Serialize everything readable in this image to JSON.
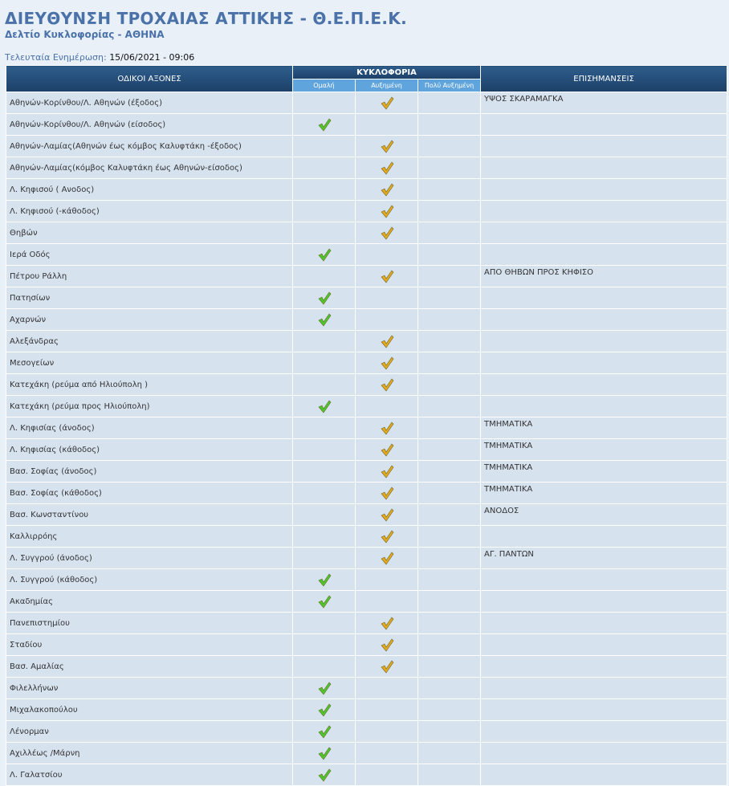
{
  "header": {
    "title": "ΔΙΕΥΘΥΝΣΗ ΤΡΟΧΑΙΑΣ ΑΤΤΙΚΗΣ - Θ.Ε.Π.Ε.Κ.",
    "subtitle": "Δελτίο Κυκλοφορίας - ΑΘΗΝΑ",
    "updated_label": "Τελευταία Ενημέρωση:",
    "updated_value": "15/06/2021 - 09:06"
  },
  "table": {
    "col_roads": "ΟΔΙΚΟΙ ΑΞΟΝΕΣ",
    "col_traffic": "ΚΥΚΛΟΦΟΡΙΑ",
    "col_notes": "ΕΠΙΣΗΜΑΝΣΕΙΣ",
    "sub_normal": "Ομαλή",
    "sub_increased": "Αυξημένη",
    "sub_very": "Πολύ Αυξημένη",
    "colors": {
      "normal_check": "#4cc92a",
      "increased_check": "#e6a81c",
      "header_dark": "#1c4068",
      "header_light": "#5fa4dd",
      "row_bg": "#d7e2ef"
    },
    "rows": [
      {
        "road": "Αθηνών-Κορίνθου/Λ. Αθηνών (έξοδος)",
        "level": "increased",
        "note": "ΥΨΟΣ ΣΚΑΡΑΜΑΓΚΑ"
      },
      {
        "road": "Αθηνών-Κορίνθου/Λ. Αθηνών (είσοδος)",
        "level": "normal",
        "note": ""
      },
      {
        "road": "Αθηνών-Λαμίας(Αθηνών έως κόμβος Καλυφτάκη -έξοδος)",
        "level": "increased",
        "note": ""
      },
      {
        "road": "Αθηνών-Λαμίας(κόμβος Καλυφτάκη έως Αθηνών-είσοδος)",
        "level": "increased",
        "note": ""
      },
      {
        "road": "Λ. Κηφισού ( Ανοδος)",
        "level": "increased",
        "note": ""
      },
      {
        "road": "Λ. Κηφισού (-κάθοδος)",
        "level": "increased",
        "note": ""
      },
      {
        "road": "Θηβών",
        "level": "increased",
        "note": ""
      },
      {
        "road": "Ιερά Οδός",
        "level": "normal",
        "note": ""
      },
      {
        "road": "Πέτρου Ράλλη",
        "level": "increased",
        "note": "ΑΠΟ ΘΗΒΩΝ ΠΡΟΣ ΚΗΦΙΣΟ"
      },
      {
        "road": "Πατησίων",
        "level": "normal",
        "note": ""
      },
      {
        "road": "Αχαρνών",
        "level": "normal",
        "note": ""
      },
      {
        "road": "Αλεξάνδρας",
        "level": "increased",
        "note": ""
      },
      {
        "road": "Μεσογείων",
        "level": "increased",
        "note": ""
      },
      {
        "road": "Κατεχάκη (ρεύμα από Ηλιούπολη )",
        "level": "increased",
        "note": ""
      },
      {
        "road": "Κατεχάκη (ρεύμα προς Ηλιούπολη)",
        "level": "normal",
        "note": ""
      },
      {
        "road": "Λ. Κηφισίας (άνοδος)",
        "level": "increased",
        "note": "ΤΜΗΜΑΤΙΚΑ"
      },
      {
        "road": "Λ. Κηφισίας (κάθοδος)",
        "level": "increased",
        "note": "ΤΜΗΜΑΤΙΚΑ"
      },
      {
        "road": "Βασ. Σοφίας (άνοδος)",
        "level": "increased",
        "note": "ΤΜΗΜΑΤΙΚΑ"
      },
      {
        "road": "Βασ. Σοφίας (κάθοδος)",
        "level": "increased",
        "note": "ΤΜΗΜΑΤΙΚΑ"
      },
      {
        "road": "Βασ. Κωνσταντίνου",
        "level": "increased",
        "note": "ΑΝΟΔΟΣ"
      },
      {
        "road": "Καλλιρρόης",
        "level": "increased",
        "note": ""
      },
      {
        "road": "Λ. Συγγρού (άνοδος)",
        "level": "increased",
        "note": "ΑΓ. ΠΑΝΤΩΝ"
      },
      {
        "road": "Λ. Συγγρού (κάθοδος)",
        "level": "normal",
        "note": ""
      },
      {
        "road": "Ακαδημίας",
        "level": "normal",
        "note": ""
      },
      {
        "road": "Πανεπιστημίου",
        "level": "increased",
        "note": ""
      },
      {
        "road": "Σταδίου",
        "level": "increased",
        "note": ""
      },
      {
        "road": "Βασ. Αμαλίας",
        "level": "increased",
        "note": ""
      },
      {
        "road": "Φιλελλήνων",
        "level": "normal",
        "note": ""
      },
      {
        "road": "Μιχαλακοπούλου",
        "level": "normal",
        "note": ""
      },
      {
        "road": "Λένορμαν",
        "level": "normal",
        "note": ""
      },
      {
        "road": "Αχιλλέως /Μάρνη",
        "level": "normal",
        "note": ""
      },
      {
        "road": "Λ. Γαλατσίου",
        "level": "normal",
        "note": ""
      }
    ]
  }
}
